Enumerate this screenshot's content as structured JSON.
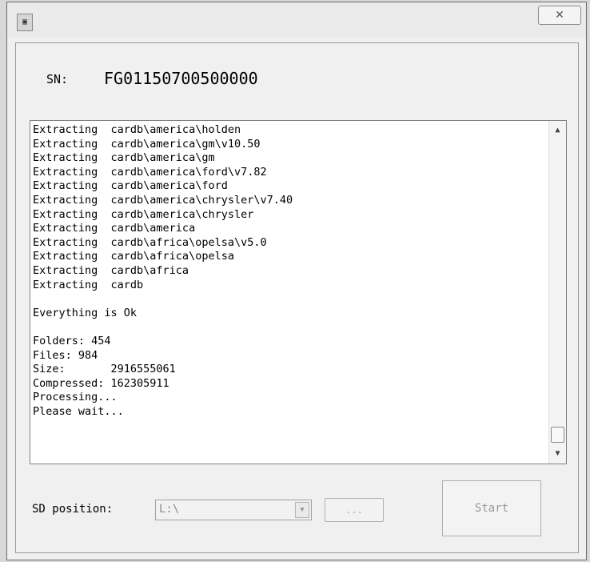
{
  "window": {
    "close_glyph": "✕"
  },
  "sn": {
    "label": "SN:",
    "value": "FG01150700500000"
  },
  "log": {
    "lines": [
      "Extracting  cardb\\america\\holden",
      "Extracting  cardb\\america\\gm\\v10.50",
      "Extracting  cardb\\america\\gm",
      "Extracting  cardb\\america\\ford\\v7.82",
      "Extracting  cardb\\america\\ford",
      "Extracting  cardb\\america\\chrysler\\v7.40",
      "Extracting  cardb\\america\\chrysler",
      "Extracting  cardb\\america",
      "Extracting  cardb\\africa\\opelsa\\v5.0",
      "Extracting  cardb\\africa\\opelsa",
      "Extracting  cardb\\africa",
      "Extracting  cardb",
      "",
      "Everything is Ok",
      "",
      "Folders: 454",
      "Files: 984",
      "Size:       2916555061",
      "Compressed: 162305911",
      "Processing...",
      "Please wait..."
    ],
    "scroll_up_glyph": "▲",
    "scroll_down_glyph": "▼"
  },
  "sd": {
    "label": "SD position:",
    "value": "L:\\",
    "dropdown_glyph": "▼",
    "browse_label": "...",
    "start_label": "Start"
  },
  "icons": {
    "app": "app-icon",
    "close": "close-icon",
    "scroll_up": "scroll-up-icon",
    "scroll_down": "scroll-down-icon",
    "dropdown": "chevron-down-icon"
  }
}
